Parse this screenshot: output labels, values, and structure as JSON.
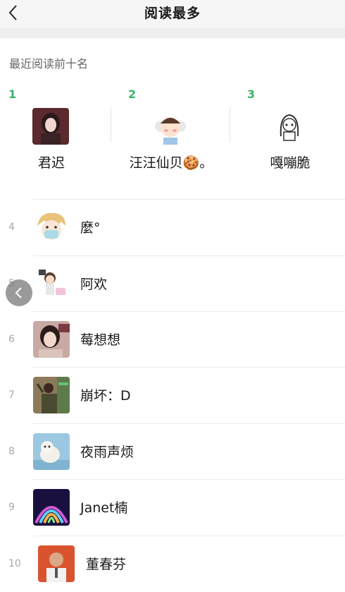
{
  "header": {
    "title": "阅读最多"
  },
  "section_label": "最近阅读前十名",
  "top3": [
    {
      "rank": "1",
      "name": "君迟"
    },
    {
      "rank": "2",
      "name": "汪汪仙贝🍪。"
    },
    {
      "rank": "3",
      "name": "嘎嘣脆"
    }
  ],
  "list": [
    {
      "rank": "4",
      "name": "麼°"
    },
    {
      "rank": "5",
      "name": "阿欢"
    },
    {
      "rank": "6",
      "name": "莓想想"
    },
    {
      "rank": "7",
      "name": "崩坏：D"
    },
    {
      "rank": "8",
      "name": "夜雨声烦"
    },
    {
      "rank": "9",
      "name": "Janet楠"
    },
    {
      "rank": "10",
      "name": "董春芬"
    }
  ],
  "colors": {
    "rank_top": "#3bb36a",
    "rank_rest": "#a8a8a8"
  },
  "icons": {
    "back": "chevron-left-icon",
    "floating_back": "chevron-left-icon"
  }
}
